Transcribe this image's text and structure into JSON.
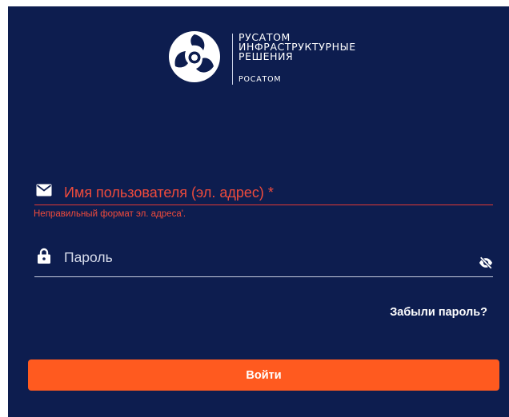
{
  "brand": {
    "line1": "РУСАТОМ",
    "line2": "ИНФРАСТРУКТУРНЫЕ",
    "line3": "РЕШЕНИЯ",
    "sub": "РОСАТОМ",
    "logo_icon": "rosatom-logo-icon"
  },
  "email_field": {
    "icon": "envelope-icon",
    "label": "Имя пользователя (эл. адрес) *",
    "error": "Неправильный формат эл. адреса'."
  },
  "password_field": {
    "icon": "lock-icon",
    "label": "Пароль",
    "toggle_icon": "eye-slash-icon"
  },
  "forgot_password": "Забыли пароль?",
  "login_button": "Войти",
  "colors": {
    "background": "#0d1d4f",
    "accent": "#ff5a1f",
    "error": "#f04b3c"
  }
}
